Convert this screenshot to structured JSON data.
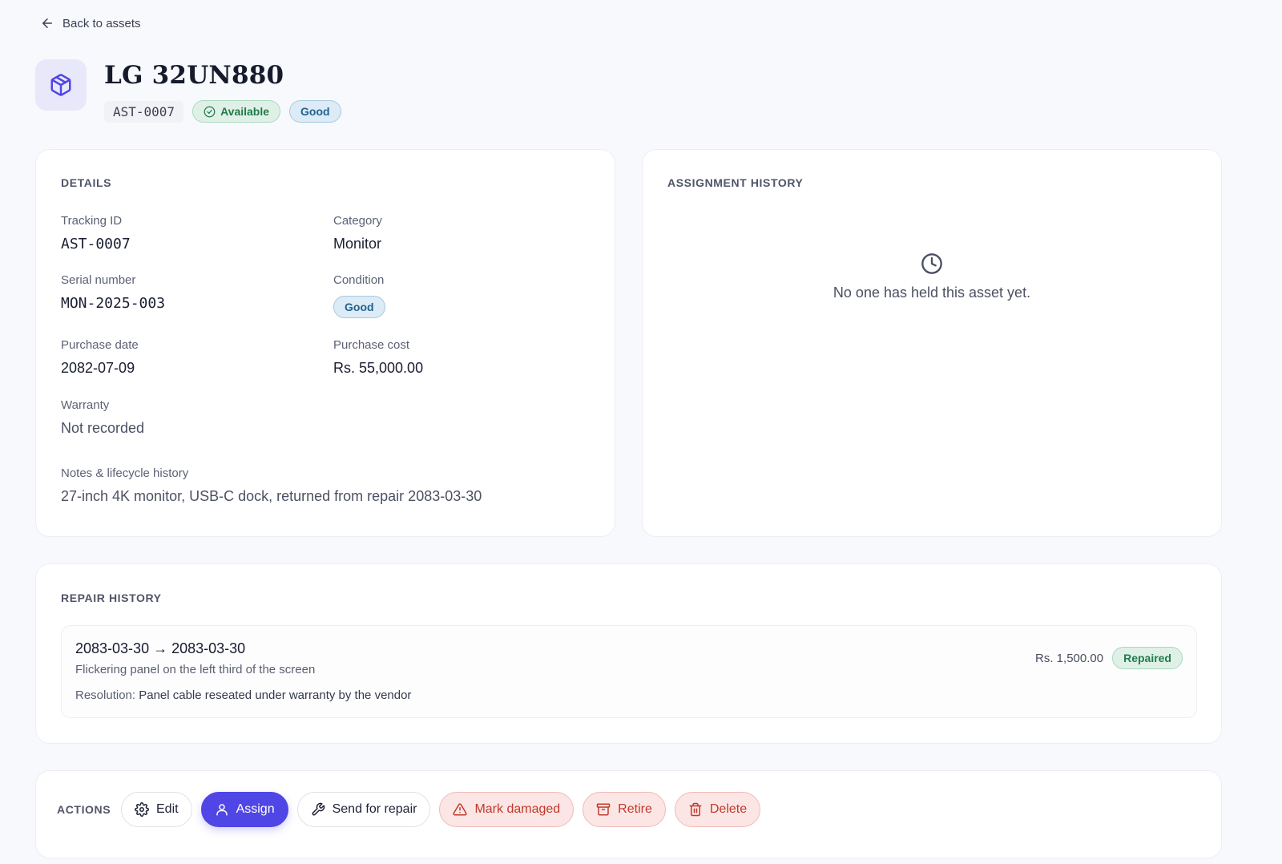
{
  "nav": {
    "back_label": "Back to assets"
  },
  "asset": {
    "name": "LG 32UN880",
    "tracking_id": "AST-0007",
    "status": "Available",
    "condition": "Good"
  },
  "details": {
    "section_title": "Details",
    "tracking_id_label": "Tracking ID",
    "tracking_id_value": "AST-0007",
    "category_label": "Category",
    "category_value": "Monitor",
    "serial_label": "Serial number",
    "serial_value": "MON-2025-003",
    "condition_label": "Condition",
    "condition_value": "Good",
    "purchase_date_label": "Purchase date",
    "purchase_date_value": "2082-07-09",
    "purchase_cost_label": "Purchase cost",
    "purchase_cost_value": "Rs. 55,000.00",
    "warranty_label": "Warranty",
    "warranty_value": "Not recorded",
    "notes_label": "Notes & lifecycle history",
    "notes_value": "27-inch 4K monitor, USB-C dock, returned from repair 2083-03-30"
  },
  "assignment_history": {
    "section_title": "Assignment history",
    "empty_text": "No one has held this asset yet."
  },
  "repair_history": {
    "section_title": "Repair history",
    "items": [
      {
        "dates": "2083-03-30 → 2083-03-30",
        "description": "Flickering panel on the left third of the screen",
        "resolution_label": "Resolution:",
        "resolution": "Panel cable reseated under warranty by the vendor",
        "cost": "Rs. 1,500.00",
        "status": "Repaired"
      }
    ]
  },
  "actions": {
    "section_title": "Actions",
    "edit": "Edit",
    "assign": "Assign",
    "send_for_repair": "Send for repair",
    "mark_damaged": "Mark damaged",
    "retire": "Retire",
    "delete": "Delete"
  },
  "colors": {
    "primary": "#4f46e5",
    "success": "#227a4c",
    "info": "#21628f",
    "danger": "#c0392b"
  },
  "icons": {
    "back": "arrow-left-icon",
    "asset": "package-icon",
    "status": "check-circle-icon",
    "empty_history": "clock-icon",
    "edit": "gear-icon",
    "assign": "user-icon",
    "repair": "wrench-icon",
    "damaged": "warning-triangle-icon",
    "retire": "archive-icon",
    "delete": "trash-icon"
  }
}
